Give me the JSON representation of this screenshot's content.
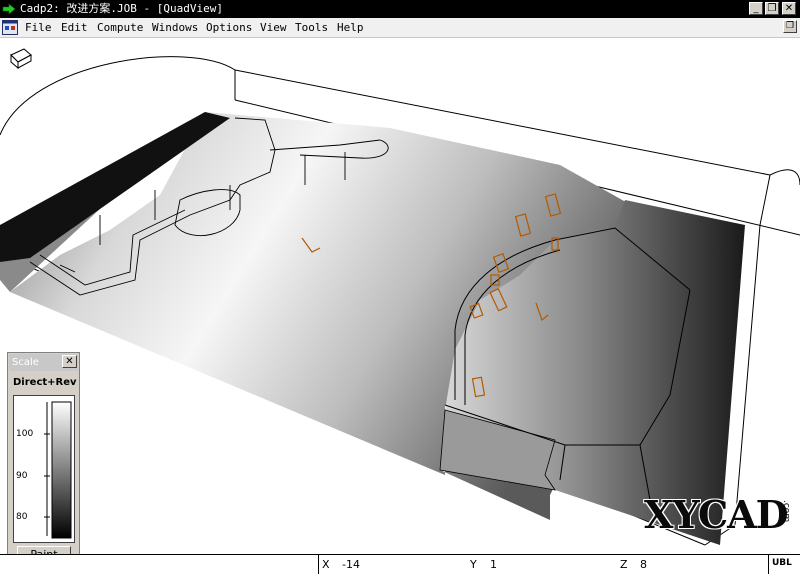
{
  "window": {
    "title": "Cadp2:  改进方案.JOB - [QuadView]",
    "minimize_label": "_",
    "restore_label": "❐",
    "close_label": "✕",
    "doc_restore_label": "❐"
  },
  "menu": {
    "items": [
      {
        "id": "file",
        "label": "File"
      },
      {
        "id": "edit",
        "label": "Edit"
      },
      {
        "id": "compute",
        "label": "Compute"
      },
      {
        "id": "windows",
        "label": "Windows"
      },
      {
        "id": "options",
        "label": "Options"
      },
      {
        "id": "view",
        "label": "View"
      },
      {
        "id": "tools",
        "label": "Tools"
      },
      {
        "id": "help",
        "label": "Help"
      }
    ]
  },
  "scale_panel": {
    "title": "Scale",
    "close_label": "✕",
    "mode_label": "Direct+Rev",
    "ticks": [
      "100",
      "90",
      "80"
    ],
    "paint_label": "Paint"
  },
  "status": {
    "x_label": "X",
    "x_value": "-14",
    "y_label": "Y",
    "y_value": "1",
    "z_label": "Z",
    "z_value": "8",
    "brand": "UBL"
  },
  "watermark": {
    "text": "XYCAD",
    "suffix": ".com"
  },
  "colors": {
    "titlebar_bg": "#000000",
    "speaker_orange": "#b35a00",
    "stage_dark": "#1a1a1a"
  },
  "icons": {
    "app": "green-arrow-icon",
    "document": "document-window-icon",
    "view_cube": "cube-icon"
  }
}
